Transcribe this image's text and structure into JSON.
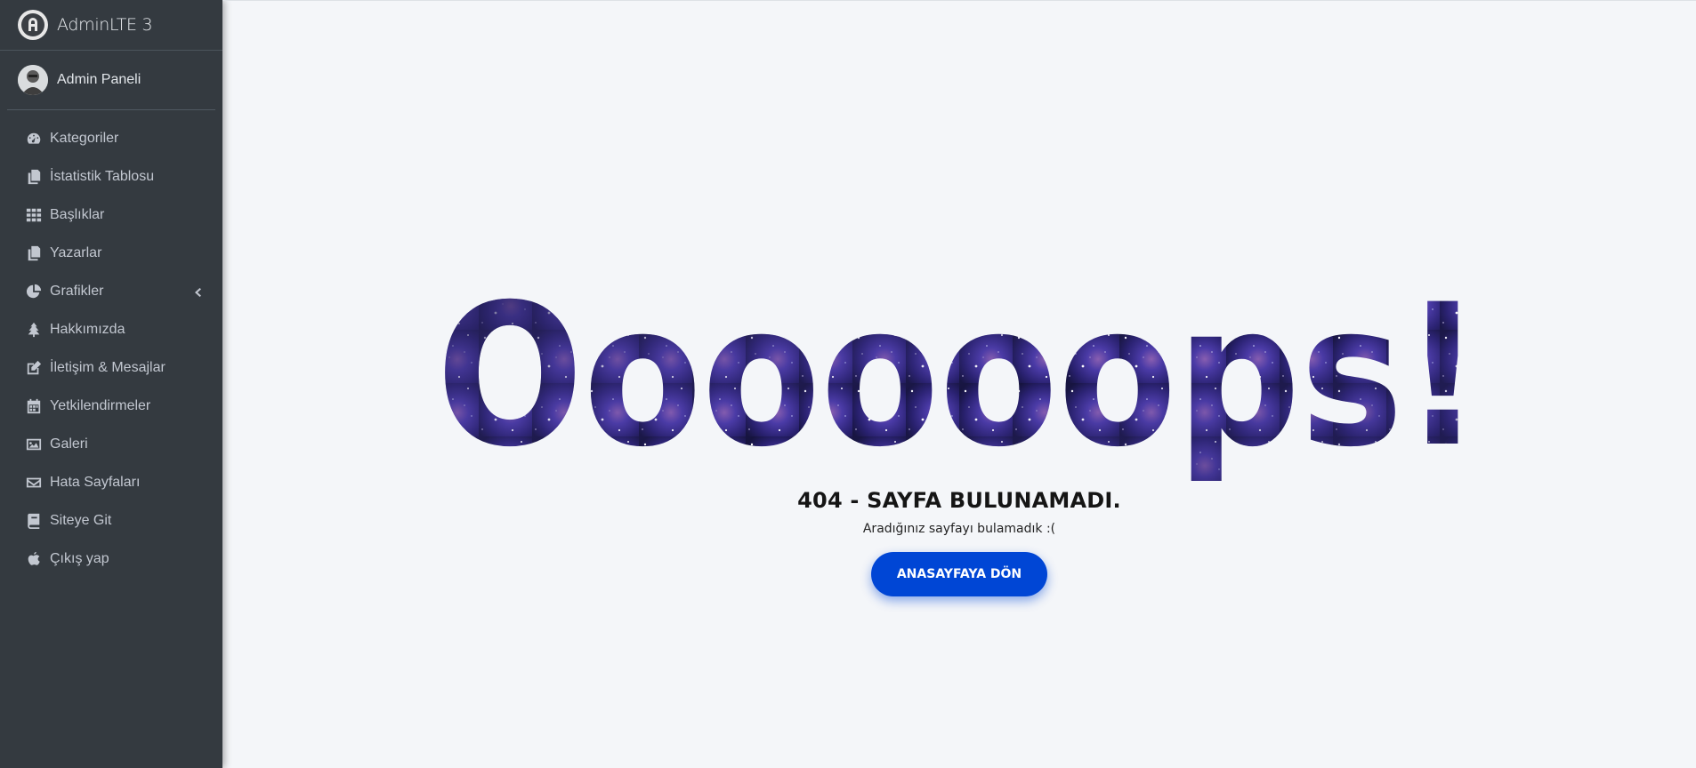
{
  "brand": {
    "title": "AdminLTE 3"
  },
  "user": {
    "name": "Admin Paneli"
  },
  "nav": {
    "items": [
      {
        "label": "Kategoriler",
        "icon": "tachometer-icon"
      },
      {
        "label": "İstatistik Tablosu",
        "icon": "copy-icon"
      },
      {
        "label": "Başlıklar",
        "icon": "grid-icon"
      },
      {
        "label": "Yazarlar",
        "icon": "copy-icon"
      },
      {
        "label": "Grafikler",
        "icon": "pie-chart-icon",
        "has_children": true
      },
      {
        "label": "Hakkımızda",
        "icon": "tree-icon"
      },
      {
        "label": "İletişim & Mesajlar",
        "icon": "edit-icon"
      },
      {
        "label": "Yetkilendirmeler",
        "icon": "calendar-icon"
      },
      {
        "label": "Galeri",
        "icon": "image-icon"
      },
      {
        "label": "Hata Sayfaları",
        "icon": "envelope-icon"
      },
      {
        "label": "Siteye Git",
        "icon": "book-icon"
      },
      {
        "label": "Çıkış yap",
        "icon": "apple-icon"
      }
    ]
  },
  "error": {
    "big_text": "Oooooops!",
    "title": "404 - SAYFA BULUNAMADI.",
    "message": "Aradığınız sayfayı bulamadık :(",
    "button_label": "ANASAYFAYA DÖN"
  },
  "colors": {
    "sidebar_bg": "#343a40",
    "page_bg": "#f4f6f9",
    "button_bg": "#0046d5",
    "space_dark": "#15133d",
    "space_purple": "#4a3aa6"
  }
}
